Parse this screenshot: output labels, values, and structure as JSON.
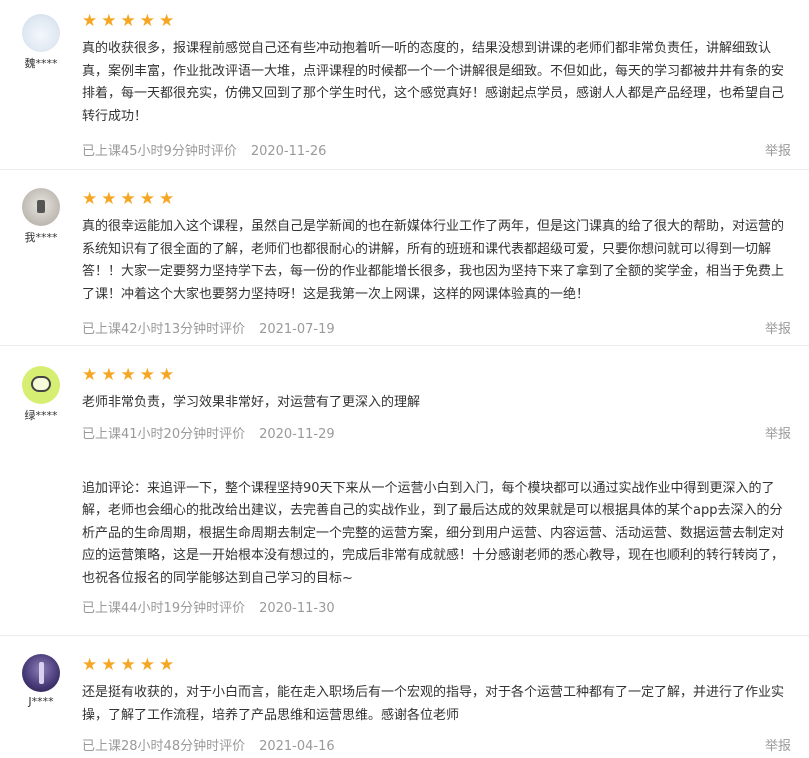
{
  "reviews": [
    {
      "username": "魏****",
      "stars": "★★★★★",
      "text": "真的收获很多，报课程前感觉自己还有些冲动抱着听一听的态度的，结果没想到讲课的老师们都非常负责任，讲解细致认真，案例丰富，作业批改评语一大堆，点评课程的时候都一个一个讲解很是细致。不但如此，每天的学习都被井井有条的安排着，每一天都很充实，仿佛又回到了那个学生时代，这个感觉真好！感谢起点学员，感谢人人都是产品经理，也希望自己转行成功！",
      "study_time": "已上课45小时9分钟时评价",
      "date": "2020-11-26",
      "report": "举报"
    },
    {
      "username": "我****",
      "stars": "★★★★★",
      "text": "真的很幸运能加入这个课程，虽然自己是学新闻的也在新媒体行业工作了两年，但是这门课真的给了很大的帮助，对运营的系统知识有了很全面的了解，老师们也都很耐心的讲解，所有的班班和课代表都超级可爱，只要你想问就可以得到一切解答！！大家一定要努力坚持学下去，每一份的作业都能增长很多，我也因为坚持下来了拿到了全额的奖学金，相当于免费上了课！冲着这个大家也要努力坚持呀！这是我第一次上网课，这样的网课体验真的一绝！",
      "study_time": "已上课42小时13分钟时评价",
      "date": "2021-07-19",
      "report": "举报"
    },
    {
      "username": "绿****",
      "stars": "★★★★★",
      "text": "老师非常负责，学习效果非常好，对运营有了更深入的理解",
      "study_time": "已上课41小时20分钟时评价",
      "date": "2020-11-29",
      "report": "举报",
      "followup": {
        "text": "追加评论：来追评一下，整个课程坚持90天下来从一个运营小白到入门，每个模块都可以通过实战作业中得到更深入的了解，老师也会细心的批改给出建议，去完善自己的实战作业，到了最后达成的效果就是可以根据具体的某个app去深入的分析产品的生命周期，根据生命周期去制定一个完整的运营方案，细分到用户运营、内容运营、活动运营、数据运营去制定对应的运营策略，这是一开始根本没有想过的，完成后非常有成就感！十分感谢老师的悉心教导，现在也顺利的转行转岗了，也祝各位报名的同学能够达到自己学习的目标~",
        "study_time": "已上课44小时19分钟时评价",
        "date": "2020-11-30"
      }
    },
    {
      "username": "J****",
      "stars": "★★★★★",
      "text": "还是挺有收获的，对于小白而言，能在走入职场后有一个宏观的指导，对于各个运营工种都有了一定了解，并进行了作业实操，了解了工作流程，培养了产品思维和运营思维。感谢各位老师",
      "study_time": "已上课28小时48分钟时评价",
      "date": "2021-04-16",
      "report": "举报"
    }
  ]
}
